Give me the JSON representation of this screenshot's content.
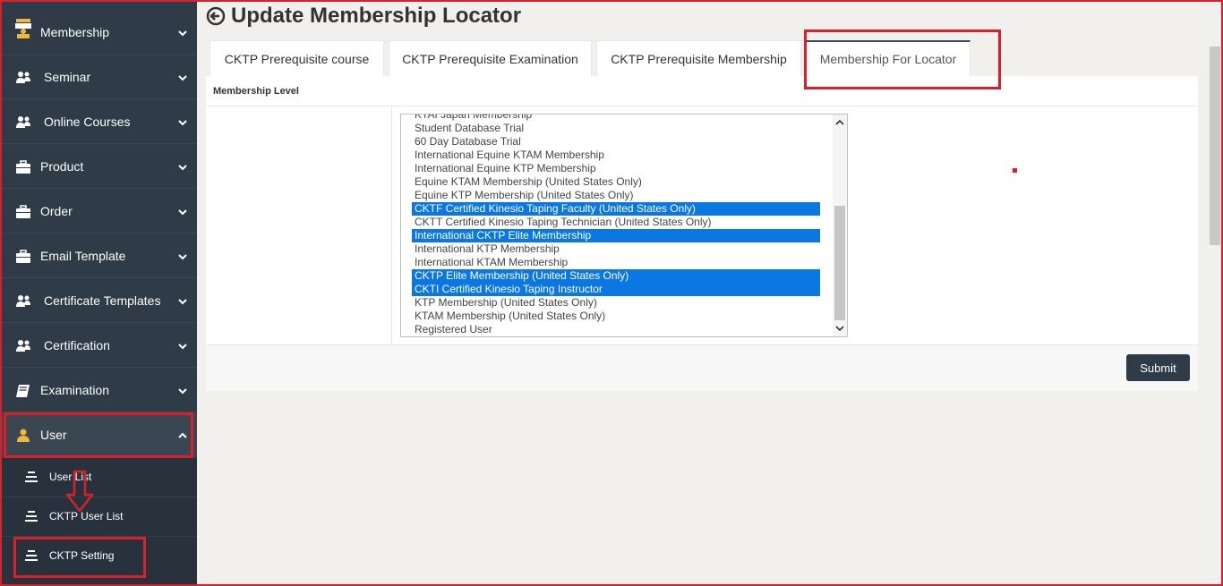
{
  "sidebar": {
    "items": [
      {
        "label": "Membership",
        "icon": "id-card-icon"
      },
      {
        "label": "Seminar",
        "icon": "users-icon"
      },
      {
        "label": "Online Courses",
        "icon": "users-icon"
      },
      {
        "label": "Product",
        "icon": "briefcase-icon"
      },
      {
        "label": "Order",
        "icon": "briefcase-icon"
      },
      {
        "label": "Email Template",
        "icon": "briefcase-icon"
      },
      {
        "label": "Certificate Templates",
        "icon": "users-icon"
      },
      {
        "label": "Certification",
        "icon": "users-icon"
      },
      {
        "label": "Examination",
        "icon": "book-icon"
      },
      {
        "label": "User",
        "icon": "user-icon"
      }
    ],
    "sub_items": [
      {
        "label": "User List"
      },
      {
        "label": "CKTP User List"
      },
      {
        "label": "CKTP Setting"
      }
    ]
  },
  "header": {
    "title": "Update Membership Locator"
  },
  "tabs": [
    {
      "label": "CKTP Prerequisite course"
    },
    {
      "label": "CKTP Prerequisite Examination"
    },
    {
      "label": "CKTP Prerequisite Membership"
    },
    {
      "label": "Membership For Locator"
    }
  ],
  "form": {
    "section_label": "Membership Level",
    "options": [
      {
        "label": "KTAI Japan Membership",
        "selected": false
      },
      {
        "label": "Student Database Trial",
        "selected": false
      },
      {
        "label": "60 Day Database Trial",
        "selected": false
      },
      {
        "label": "International Equine KTAM Membership",
        "selected": false
      },
      {
        "label": "International Equine KTP Membership",
        "selected": false
      },
      {
        "label": "Equine KTAM Membership (United States Only)",
        "selected": false
      },
      {
        "label": "Equine KTP Membership (United States Only)",
        "selected": false
      },
      {
        "label": "CKTF Certified Kinesio Taping Faculty (United States Only)",
        "selected": true
      },
      {
        "label": "CKTT Certified Kinesio Taping Technician (United States Only)",
        "selected": false
      },
      {
        "label": "International CKTP Elite Membership",
        "selected": true
      },
      {
        "label": "International KTP Membership",
        "selected": false
      },
      {
        "label": "International KTAM Membership",
        "selected": false
      },
      {
        "label": "CKTP Elite Membership (United States Only)",
        "selected": true
      },
      {
        "label": "CKTI Certified Kinesio Taping Instructor",
        "selected": true
      },
      {
        "label": "KTP Membership (United States Only)",
        "selected": false
      },
      {
        "label": "KTAM Membership (United States Only)",
        "selected": false
      },
      {
        "label": "Registered User",
        "selected": false
      }
    ],
    "submit_label": "Submit"
  },
  "colors": {
    "sidebar_bg": "#2f3b46",
    "selected_option": "#0a77e3",
    "highlight": "#d9202a",
    "user_icon": "#f0b73a"
  }
}
